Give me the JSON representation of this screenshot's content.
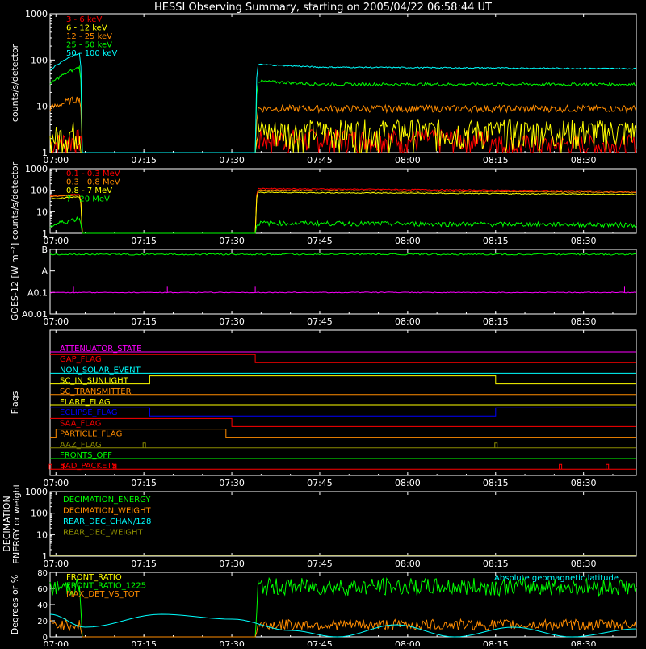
{
  "title": "HESSI Observing Summary, starting on 2005/04/22 06:58:44 UT",
  "time_ticks": [
    "07:00",
    "07:15",
    "07:30",
    "07:45",
    "08:00",
    "08:15",
    "08:30"
  ],
  "colors": {
    "red": "#ff0000",
    "orange": "#ff8c00",
    "yellow": "#ffff00",
    "green": "#00ff00",
    "cyan": "#00ffff",
    "magenta": "#ff00ff",
    "blue": "#0000ff",
    "olive": "#8c8c00",
    "white": "#ffffff"
  },
  "chart_data": [
    {
      "type": "line",
      "ylabel": "counts/s/detector",
      "yscale": "log",
      "ylim": [
        1,
        1000
      ],
      "ytick_labels": [
        "1",
        "10",
        "100",
        "1000"
      ],
      "series": [
        {
          "name": "3 - 6 keV",
          "color": "red",
          "x": [
            "06:59",
            "07:04",
            "07:04:30",
            "07:34",
            "07:34:30",
            "08:15",
            "08:16",
            "08:39"
          ],
          "y": [
            1.5,
            2,
            1,
            1,
            2,
            2,
            1.5,
            1.5
          ]
        },
        {
          "name": "6 - 12 keV",
          "color": "yellow",
          "x": [
            "06:59",
            "07:04",
            "07:04:30",
            "07:34",
            "07:34:30",
            "08:39"
          ],
          "y": [
            2,
            3,
            1,
            1,
            3,
            3
          ]
        },
        {
          "name": "12 - 25 keV",
          "color": "orange",
          "x": [
            "06:59",
            "07:04",
            "07:04:30",
            "07:34",
            "07:34:30",
            "08:39"
          ],
          "y": [
            9,
            15,
            1,
            1,
            9,
            9
          ]
        },
        {
          "name": "25 - 50 keV",
          "color": "green",
          "x": [
            "06:59",
            "07:04",
            "07:04:30",
            "07:34",
            "07:34:30",
            "07:45",
            "08:39"
          ],
          "y": [
            30,
            70,
            1,
            1,
            35,
            30,
            30
          ]
        },
        {
          "name": "50 - 100 keV",
          "color": "cyan",
          "x": [
            "06:59",
            "07:04",
            "07:04:30",
            "07:34",
            "07:34:30",
            "07:45",
            "08:39"
          ],
          "y": [
            60,
            140,
            1,
            1,
            80,
            70,
            65
          ]
        }
      ]
    },
    {
      "type": "line",
      "ylabel": "counts/s/detector",
      "yscale": "log",
      "ylim": [
        1,
        1000
      ],
      "ytick_labels": [
        "1",
        "10",
        "100",
        "1000"
      ],
      "series": [
        {
          "name": "0.1 - 0.3 MeV",
          "color": "red",
          "x": [
            "06:59",
            "07:04",
            "07:04:30",
            "07:34",
            "07:34:30",
            "08:39"
          ],
          "y": [
            55,
            65,
            1,
            1,
            120,
            90
          ]
        },
        {
          "name": "0.3 - 0.8 MeV",
          "color": "orange",
          "x": [
            "06:59",
            "07:04",
            "07:04:30",
            "07:34",
            "07:34:30",
            "08:39"
          ],
          "y": [
            50,
            60,
            1,
            1,
            100,
            80
          ]
        },
        {
          "name": "0.8 - 7 MeV",
          "color": "yellow",
          "x": [
            "06:59",
            "07:04",
            "07:04:30",
            "07:34",
            "07:34:30",
            "08:39"
          ],
          "y": [
            40,
            50,
            1,
            1,
            80,
            65
          ]
        },
        {
          "name": "7 - 20 MeV",
          "color": "green",
          "x": [
            "06:59",
            "07:04",
            "07:04:30",
            "07:34",
            "07:34:30",
            "08:39"
          ],
          "y": [
            2,
            5,
            1,
            1,
            3,
            2.5
          ]
        }
      ]
    },
    {
      "type": "line",
      "ylabel": "GOES-12 [W m⁻²]",
      "yscale": "log",
      "ytick_labels": [
        "A0.01",
        "A0.1",
        "A",
        "B"
      ],
      "series": [
        {
          "name": "GOES low",
          "color": "green",
          "x": [
            "06:59",
            "07:15",
            "07:30",
            "08:39"
          ],
          "y_level": [
            "B",
            "B",
            "B",
            "B"
          ]
        },
        {
          "name": "GOES high",
          "color": "magenta",
          "x": [
            "06:59",
            "08:39"
          ],
          "y_level": [
            "A0.1",
            "A0.1"
          ],
          "spikes": [
            "07:03",
            "07:19",
            "07:34",
            "08:37"
          ]
        }
      ]
    },
    {
      "type": "line",
      "ylabel": "Flags",
      "series": [
        {
          "name": "ATTENUATOR_STATE",
          "color": "magenta",
          "states": [
            [
              0,
              "06:59",
              "08:39"
            ]
          ]
        },
        {
          "name": "GAP_FLAG",
          "color": "red",
          "states": [
            [
              1,
              "06:59",
              "07:34"
            ],
            [
              0,
              "07:34",
              "08:39"
            ]
          ]
        },
        {
          "name": "NON_SOLAR_EVENT",
          "color": "cyan",
          "states": [
            [
              0,
              "06:59",
              "08:39"
            ]
          ]
        },
        {
          "name": "SC_IN_SUNLIGHT",
          "color": "yellow",
          "states": [
            [
              0,
              "06:59",
              "07:16"
            ],
            [
              1,
              "07:16",
              "08:15"
            ],
            [
              0,
              "08:15",
              "08:39"
            ]
          ]
        },
        {
          "name": "SC_TRANSMITTER",
          "color": "orange",
          "states": [
            [
              0,
              "06:59",
              "08:39"
            ]
          ]
        },
        {
          "name": "FLARE_FLAG",
          "color": "yellow",
          "states": [
            [
              0,
              "06:59",
              "08:39"
            ]
          ]
        },
        {
          "name": "ECLIPSE_FLAG",
          "color": "blue",
          "states": [
            [
              1,
              "06:59",
              "07:16"
            ],
            [
              0,
              "07:16",
              "08:15"
            ],
            [
              1,
              "08:15",
              "08:39"
            ]
          ]
        },
        {
          "name": "SAA_FLAG",
          "color": "red",
          "states": [
            [
              1,
              "06:59",
              "07:30"
            ],
            [
              0,
              "07:30",
              "08:39"
            ]
          ]
        },
        {
          "name": "PARTICLE_FLAG",
          "color": "orange",
          "states": [
            [
              0,
              "06:59",
              "07:00"
            ],
            [
              1,
              "07:00",
              "07:29"
            ],
            [
              0,
              "07:29",
              "08:39"
            ]
          ]
        },
        {
          "name": "AAZ_FLAG",
          "color": "olive",
          "states": [
            [
              0,
              "06:59",
              "08:39"
            ]
          ],
          "blips": [
            "07:15",
            "08:15"
          ]
        },
        {
          "name": "FRONTS_OFF",
          "color": "green",
          "states": [
            [
              0,
              "06:59",
              "08:39"
            ]
          ]
        },
        {
          "name": "BAD_PACKETS",
          "color": "red",
          "states": [
            [
              0,
              "06:59",
              "08:39"
            ]
          ],
          "blips": [
            "06:59",
            "07:01",
            "07:10",
            "08:26",
            "08:34"
          ]
        }
      ]
    },
    {
      "type": "line",
      "ylabel": "DECIMATION ENERGY or weight",
      "yscale": "log",
      "ylim": [
        1,
        1000
      ],
      "ytick_labels": [
        "1",
        "10",
        "100",
        "1000"
      ],
      "series": [
        {
          "name": "DECIMATION_ENERGY",
          "color": "green",
          "x": [],
          "y": []
        },
        {
          "name": "DECIMATION_WEIGHT",
          "color": "orange",
          "x": [],
          "y": []
        },
        {
          "name": "REAR_DEC_CHAN/128",
          "color": "cyan",
          "x": [],
          "y": []
        },
        {
          "name": "REAR_DEC_WEIGHT",
          "color": "olive",
          "x": [
            "06:59",
            "08:39"
          ],
          "y": [
            1,
            1
          ]
        }
      ]
    },
    {
      "type": "line",
      "ylabel": "Degrees or %",
      "ylim": [
        0,
        80
      ],
      "ytick_labels": [
        "0",
        "20",
        "40",
        "60",
        "80"
      ],
      "annotation": "Absolute geomagnetic latitude",
      "series": [
        {
          "name": "FRONT_RATIO",
          "color": "yellow",
          "x": [],
          "y": []
        },
        {
          "name": "FRONT_RATIO_1225",
          "color": "green",
          "x": [
            "06:59",
            "07:04",
            "07:04:30",
            "07:34",
            "07:34:30",
            "08:39"
          ],
          "y": [
            60,
            62,
            0,
            0,
            62,
            62
          ]
        },
        {
          "name": "MAX_DET_VS_TOT",
          "color": "orange",
          "x": [
            "06:59",
            "07:04",
            "07:04:30",
            "07:34",
            "07:34:30",
            "08:39"
          ],
          "y": [
            15,
            15,
            0,
            0,
            15,
            15
          ]
        },
        {
          "name": "Absolute geomagnetic latitude",
          "color": "cyan",
          "x": [
            "06:59",
            "07:05",
            "07:18",
            "07:30",
            "07:40",
            "07:48",
            "07:58",
            "08:08",
            "08:18",
            "08:28",
            "08:39"
          ],
          "y": [
            28,
            12,
            28,
            22,
            8,
            0,
            15,
            0,
            12,
            0,
            10
          ]
        }
      ]
    }
  ]
}
